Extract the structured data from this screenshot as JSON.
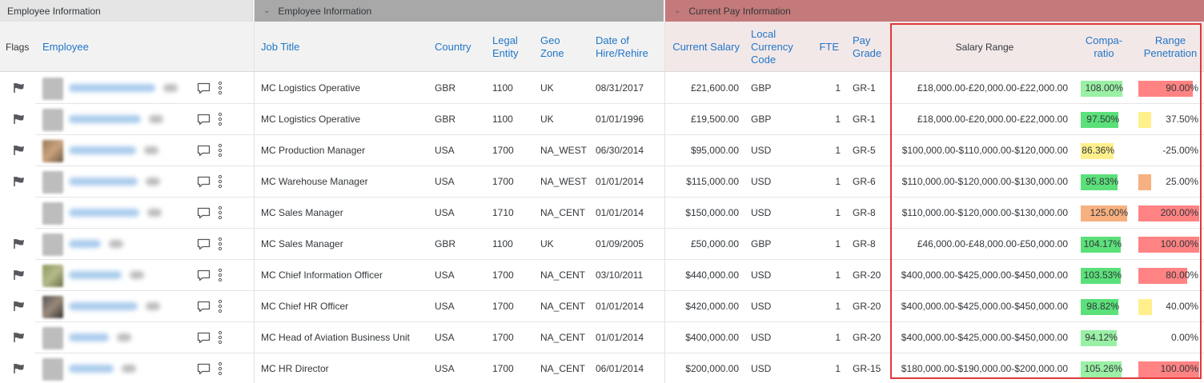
{
  "groups": [
    {
      "label": "Employee Information",
      "chevron": false
    },
    {
      "label": "Employee Information",
      "chevron": true
    },
    {
      "label": "Current Pay Information",
      "chevron": true
    }
  ],
  "headers": {
    "flags": "Flags",
    "employee": "Employee",
    "job_title": "Job Title",
    "country": "Country",
    "legal_entity": "Legal Entity",
    "geo_zone": "Geo Zone",
    "hire_date": "Date of Hire/Rehire",
    "current_salary": "Current Salary",
    "local_currency": "Local Currency Code",
    "fte": "FTE",
    "pay_grade": "Pay Grade",
    "salary_range": "Salary Range",
    "compa_ratio": "Compa-ratio",
    "range_penetration": "Range Penetration"
  },
  "colors": {
    "green": "#5be07a",
    "light_green": "#9af0a5",
    "yellow": "#fff08c",
    "orange": "#f7b07f",
    "red": "#ff8383",
    "highlight_border": "#e0383c"
  },
  "rows": [
    {
      "flag": true,
      "job_title": "MC Logistics Operative",
      "country": "GBR",
      "legal_entity": "1100",
      "geo_zone": "UK",
      "hire_date": "08/31/2017",
      "current_salary": "£21,600.00",
      "currency": "GBP",
      "fte": "1",
      "pay_grade": "GR-1",
      "salary_range": "£18,000.00-£20,000.00-£22,000.00",
      "compa_ratio": "108.00%",
      "compa_value": 108.0,
      "compa_color": "light_green",
      "range_penetration": "90.00%",
      "penetration_value": 90.0,
      "penetration_color": "red"
    },
    {
      "flag": true,
      "job_title": "MC Logistics Operative",
      "country": "GBR",
      "legal_entity": "1100",
      "geo_zone": "UK",
      "hire_date": "01/01/1996",
      "current_salary": "£19,500.00",
      "currency": "GBP",
      "fte": "1",
      "pay_grade": "GR-1",
      "salary_range": "£18,000.00-£20,000.00-£22,000.00",
      "compa_ratio": "97.50%",
      "compa_value": 97.5,
      "compa_color": "green",
      "range_penetration": "37.50%",
      "penetration_value": 37.5,
      "penetration_color": "yellow"
    },
    {
      "flag": true,
      "job_title": "MC Production Manager",
      "country": "USA",
      "legal_entity": "1700",
      "geo_zone": "NA_WEST",
      "hire_date": "06/30/2014",
      "current_salary": "$95,000.00",
      "currency": "USD",
      "fte": "1",
      "pay_grade": "GR-5",
      "salary_range": "$100,000.00-$110,000.00-$120,000.00",
      "compa_ratio": "86.36%",
      "compa_value": 86.36,
      "compa_color": "yellow",
      "range_penetration": "-25.00%",
      "penetration_value": -25.0,
      "penetration_color": "none"
    },
    {
      "flag": true,
      "job_title": "MC Warehouse Manager",
      "country": "USA",
      "legal_entity": "1700",
      "geo_zone": "NA_WEST",
      "hire_date": "01/01/2014",
      "current_salary": "$115,000.00",
      "currency": "USD",
      "fte": "1",
      "pay_grade": "GR-6",
      "salary_range": "$110,000.00-$120,000.00-$130,000.00",
      "compa_ratio": "95.83%",
      "compa_value": 95.83,
      "compa_color": "green",
      "range_penetration": "25.00%",
      "penetration_value": 25.0,
      "penetration_color": "orange"
    },
    {
      "flag": false,
      "job_title": "MC Sales Manager",
      "country": "USA",
      "legal_entity": "1710",
      "geo_zone": "NA_CENT",
      "hire_date": "01/01/2014",
      "current_salary": "$150,000.00",
      "currency": "USD",
      "fte": "1",
      "pay_grade": "GR-8",
      "salary_range": "$110,000.00-$120,000.00-$130,000.00",
      "compa_ratio": "125.00%",
      "compa_value": 125.0,
      "compa_color": "orange",
      "range_penetration": "200.00%",
      "penetration_value": 200.0,
      "penetration_color": "red"
    },
    {
      "flag": true,
      "job_title": "MC Sales Manager",
      "country": "GBR",
      "legal_entity": "1100",
      "geo_zone": "UK",
      "hire_date": "01/09/2005",
      "current_salary": "£50,000.00",
      "currency": "GBP",
      "fte": "1",
      "pay_grade": "GR-8",
      "salary_range": "£46,000.00-£48,000.00-£50,000.00",
      "compa_ratio": "104.17%",
      "compa_value": 104.17,
      "compa_color": "green",
      "range_penetration": "100.00%",
      "penetration_value": 100.0,
      "penetration_color": "red"
    },
    {
      "flag": true,
      "job_title": "MC Chief Information Officer",
      "country": "USA",
      "legal_entity": "1700",
      "geo_zone": "NA_CENT",
      "hire_date": "03/10/2011",
      "current_salary": "$440,000.00",
      "currency": "USD",
      "fte": "1",
      "pay_grade": "GR-20",
      "salary_range": "$400,000.00-$425,000.00-$450,000.00",
      "compa_ratio": "103.53%",
      "compa_value": 103.53,
      "compa_color": "green",
      "range_penetration": "80.00%",
      "penetration_value": 80.0,
      "penetration_color": "red"
    },
    {
      "flag": true,
      "job_title": "MC Chief HR Officer",
      "country": "USA",
      "legal_entity": "1700",
      "geo_zone": "NA_CENT",
      "hire_date": "01/01/2014",
      "current_salary": "$420,000.00",
      "currency": "USD",
      "fte": "1",
      "pay_grade": "GR-20",
      "salary_range": "$400,000.00-$425,000.00-$450,000.00",
      "compa_ratio": "98.82%",
      "compa_value": 98.82,
      "compa_color": "green",
      "range_penetration": "40.00%",
      "penetration_value": 40.0,
      "penetration_color": "yellow"
    },
    {
      "flag": true,
      "job_title": "MC Head of Aviation Business Unit",
      "country": "USA",
      "legal_entity": "1700",
      "geo_zone": "NA_CENT",
      "hire_date": "01/01/2014",
      "current_salary": "$400,000.00",
      "currency": "USD",
      "fte": "1",
      "pay_grade": "GR-20",
      "salary_range": "$400,000.00-$425,000.00-$450,000.00",
      "compa_ratio": "94.12%",
      "compa_value": 94.12,
      "compa_color": "light_green",
      "range_penetration": "0.00%",
      "penetration_value": 0.0,
      "penetration_color": "none"
    },
    {
      "flag": true,
      "job_title": "MC HR Director",
      "country": "USA",
      "legal_entity": "1700",
      "geo_zone": "NA_CENT",
      "hire_date": "06/01/2014",
      "current_salary": "$200,000.00",
      "currency": "USD",
      "fte": "1",
      "pay_grade": "GR-15",
      "salary_range": "$180,000.00-$190,000.00-$200,000.00",
      "compa_ratio": "105.26%",
      "compa_value": 105.26,
      "compa_color": "light_green",
      "range_penetration": "100.00%",
      "penetration_value": 100.0,
      "penetration_color": "red"
    }
  ]
}
